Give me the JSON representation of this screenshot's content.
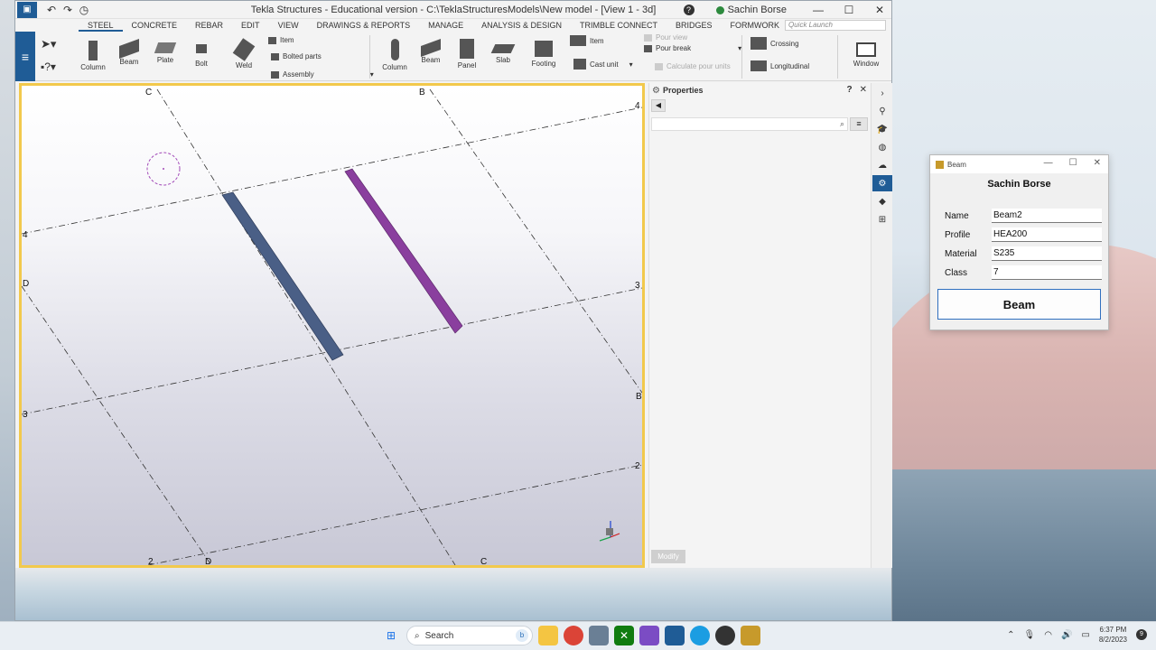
{
  "window": {
    "title": "Tekla Structures - Educational version - C:\\TeklaStructuresModels\\New model - [View 1 - 3d]",
    "user": "Sachin Borse"
  },
  "menu_tabs": [
    "STEEL",
    "CONCRETE",
    "REBAR",
    "EDIT",
    "VIEW",
    "DRAWINGS & REPORTS",
    "MANAGE",
    "ANALYSIS & DESIGN",
    "TRIMBLE CONNECT",
    "BRIDGES",
    "FORMWORK"
  ],
  "quick_launch_placeholder": "Quick Launch",
  "ribbon": {
    "steel": {
      "column": "Column",
      "beam": "Beam",
      "plate": "Plate",
      "bolt": "Bolt",
      "weld": "Weld",
      "item": "Item",
      "bolted_parts": "Bolted parts",
      "assembly": "Assembly"
    },
    "concrete": {
      "column": "Column",
      "beam": "Beam",
      "panel": "Panel",
      "slab": "Slab",
      "footing": "Footing",
      "item": "Item",
      "cast_unit": "Cast unit",
      "pour_view": "Pour view",
      "pour_break": "Pour break",
      "calc_pour_units": "Calculate pour units"
    },
    "rebar": {
      "crossing": "Crossing",
      "longitudinal": "Longitudinal"
    },
    "window": "Window"
  },
  "viewport": {
    "grid_labels": {
      "c_top": "C",
      "b_top": "B",
      "four_right": "4",
      "four_left": "4",
      "d_left": "D",
      "three_right": "3",
      "three_left": "3",
      "b_right": "B",
      "two_right": "2",
      "two_bottom": "2",
      "d_bottom": "D",
      "c_bottom": "C"
    },
    "colors": {
      "beam_blue": "#4a5f86",
      "beam_purple": "#8a3f9e",
      "frame": "#f2c94c"
    }
  },
  "properties": {
    "title": "Properties",
    "modify_label": "Modify"
  },
  "vertical_toolbar": [
    "chevron-right",
    "search-settings",
    "graduation",
    "globe",
    "cloud",
    "gear",
    "cube",
    "apps"
  ],
  "beam_dialog": {
    "title": "Beam",
    "heading": "Sachin Borse",
    "fields": [
      {
        "label": "Name",
        "value": "Beam2"
      },
      {
        "label": "Profile",
        "value": "HEA200"
      },
      {
        "label": "Material",
        "value": "S235"
      },
      {
        "label": "Class",
        "value": "7"
      }
    ],
    "button_label": "Beam"
  },
  "taskbar": {
    "search_label": "Search",
    "time": "6:37 PM",
    "date": "8/2/2023",
    "notification_count": "9"
  }
}
